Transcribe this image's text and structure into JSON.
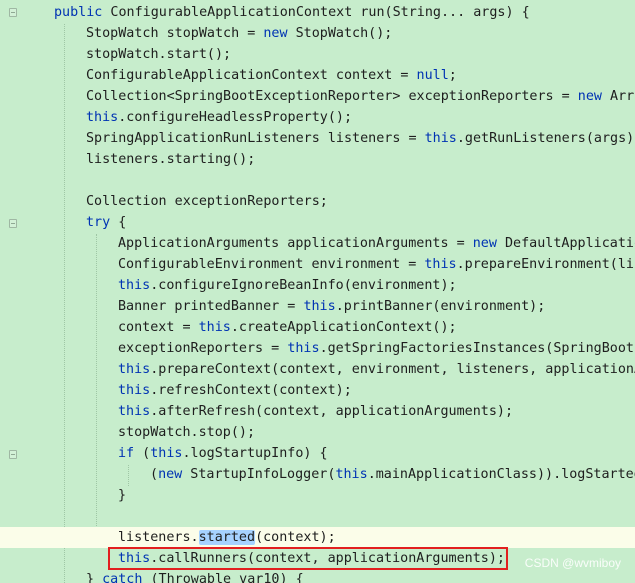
{
  "lines": [
    {
      "parts": [
        {
          "t": "public",
          "k": "kw"
        },
        {
          "t": " ConfigurableApplicationContext run(String... args) {"
        }
      ]
    },
    {
      "parts": [
        {
          "t": "StopWatch stopWatch = "
        },
        {
          "t": "new",
          "k": "kw"
        },
        {
          "t": " StopWatch();"
        }
      ]
    },
    {
      "parts": [
        {
          "t": "stopWatch.start();"
        }
      ]
    },
    {
      "parts": [
        {
          "t": "ConfigurableApplicationContext context = "
        },
        {
          "t": "null",
          "k": "kw"
        },
        {
          "t": ";"
        }
      ]
    },
    {
      "parts": [
        {
          "t": "Collection<SpringBootExceptionReporter> exceptionReporters = "
        },
        {
          "t": "new",
          "k": "kw"
        },
        {
          "t": " Arra"
        }
      ]
    },
    {
      "parts": [
        {
          "t": "this",
          "k": "kw"
        },
        {
          "t": ".configureHeadlessProperty();"
        }
      ]
    },
    {
      "parts": [
        {
          "t": "SpringApplicationRunListeners listeners = "
        },
        {
          "t": "this",
          "k": "kw"
        },
        {
          "t": ".getRunListeners(args);"
        }
      ]
    },
    {
      "parts": [
        {
          "t": "listeners.starting();"
        }
      ]
    },
    {
      "parts": []
    },
    {
      "parts": [
        {
          "t": "Collection exceptionReporters;"
        }
      ]
    },
    {
      "parts": [
        {
          "t": "try",
          "k": "kw"
        },
        {
          "t": " {"
        }
      ]
    },
    {
      "parts": [
        {
          "t": "ApplicationArguments applicationArguments = "
        },
        {
          "t": "new",
          "k": "kw"
        },
        {
          "t": " DefaultApplicatio"
        }
      ]
    },
    {
      "parts": [
        {
          "t": "ConfigurableEnvironment environment = "
        },
        {
          "t": "this",
          "k": "kw"
        },
        {
          "t": ".prepareEnvironment(lis"
        }
      ]
    },
    {
      "parts": [
        {
          "t": "this",
          "k": "kw"
        },
        {
          "t": ".configureIgnoreBeanInfo(environment);"
        }
      ]
    },
    {
      "parts": [
        {
          "t": "Banner printedBanner = "
        },
        {
          "t": "this",
          "k": "kw"
        },
        {
          "t": ".printBanner(environment);"
        }
      ]
    },
    {
      "parts": [
        {
          "t": "context = "
        },
        {
          "t": "this",
          "k": "kw"
        },
        {
          "t": ".createApplicationContext();"
        }
      ]
    },
    {
      "parts": [
        {
          "t": "exceptionReporters = "
        },
        {
          "t": "this",
          "k": "kw"
        },
        {
          "t": ".getSpringFactoriesInstances(SpringBootE"
        }
      ]
    },
    {
      "parts": [
        {
          "t": "this",
          "k": "kw"
        },
        {
          "t": ".prepareContext(context, environment, listeners, applicationA"
        }
      ]
    },
    {
      "parts": [
        {
          "t": "this",
          "k": "kw"
        },
        {
          "t": ".refreshContext(context);"
        }
      ]
    },
    {
      "parts": [
        {
          "t": "this",
          "k": "kw"
        },
        {
          "t": ".afterRefresh(context, applicationArguments);"
        }
      ]
    },
    {
      "parts": [
        {
          "t": "stopWatch.stop();"
        }
      ]
    },
    {
      "parts": [
        {
          "t": "if",
          "k": "kw"
        },
        {
          "t": " ("
        },
        {
          "t": "this",
          "k": "kw"
        },
        {
          "t": ".logStartupInfo) {"
        }
      ]
    },
    {
      "parts": [
        {
          "t": "("
        },
        {
          "t": "new",
          "k": "kw"
        },
        {
          "t": " StartupInfoLogger("
        },
        {
          "t": "this",
          "k": "kw"
        },
        {
          "t": ".mainApplicationClass)).logStarted"
        }
      ]
    },
    {
      "parts": [
        {
          "t": "}"
        }
      ]
    },
    {
      "parts": []
    },
    {
      "parts": [
        {
          "t": "listeners."
        },
        {
          "t": "started",
          "k": "sel"
        },
        {
          "t": "(context);"
        }
      ]
    },
    {
      "parts": [
        {
          "t": "this",
          "k": "kw"
        },
        {
          "t": ".callRunners(context, applicationArguments);"
        }
      ]
    },
    {
      "parts": [
        {
          "t": "} "
        },
        {
          "t": "catch",
          "k": "kw"
        },
        {
          "t": " (Throwable var10) {"
        }
      ]
    }
  ],
  "watermark": "CSDN @wvmiboy"
}
